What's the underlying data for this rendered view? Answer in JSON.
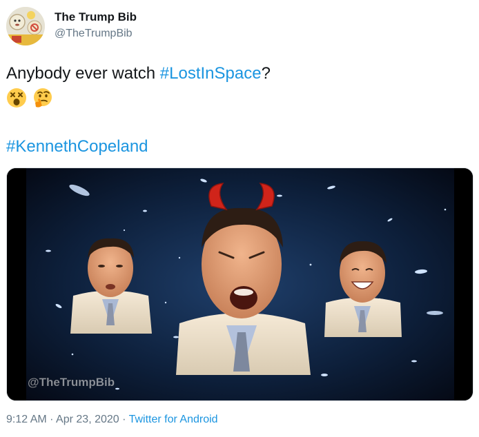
{
  "author": {
    "display_name": "The Trump Bib",
    "handle": "@TheTrumpBib"
  },
  "tweet": {
    "text_before": "Anybody ever watch ",
    "hashtag_1": "#LostInSpace",
    "text_after": "?",
    "emojis": [
      "dizzy-face-emoji",
      "thinking-face-emoji"
    ],
    "hashtag_2": "#KennethCopeland"
  },
  "media": {
    "watermark": "@TheTrumpBib",
    "description_icons": [
      "starfield-background",
      "man-face-left",
      "man-face-center-with-devil-horns",
      "man-face-right"
    ]
  },
  "meta": {
    "time": "9:12 AM",
    "separator": " · ",
    "date": "Apr 23, 2020",
    "source": "Twitter for Android"
  },
  "colors": {
    "link": "#1b95e0",
    "secondary_text": "#657786",
    "primary_text": "#14171a"
  }
}
